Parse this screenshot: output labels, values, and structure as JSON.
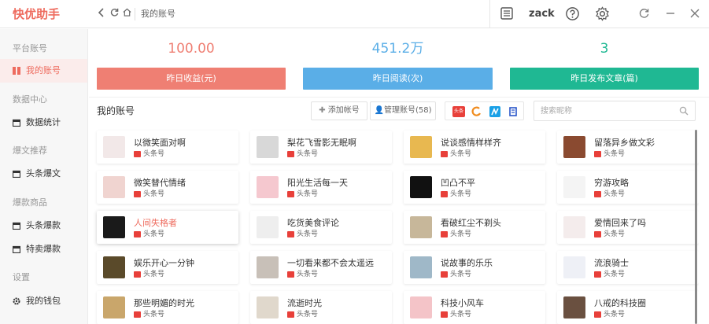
{
  "app": {
    "title": "快优助手",
    "breadcrumb": "我的账号",
    "user": "zack"
  },
  "sidebar": {
    "groups": [
      {
        "label": "平台账号",
        "items": [
          {
            "label": "我的账号",
            "icon": "account-icon",
            "active": true
          }
        ]
      },
      {
        "label": "数据中心",
        "items": [
          {
            "label": "数据统计",
            "icon": "calendar-icon",
            "active": false
          }
        ]
      },
      {
        "label": "爆文推荐",
        "items": [
          {
            "label": "头条爆文",
            "icon": "calendar-icon",
            "active": false
          }
        ]
      },
      {
        "label": "爆款商品",
        "items": [
          {
            "label": "头条爆款",
            "icon": "calendar-icon",
            "active": false
          },
          {
            "label": "特卖爆款",
            "icon": "calendar-icon",
            "active": false
          }
        ]
      },
      {
        "label": "设置",
        "items": [
          {
            "label": "我的钱包",
            "icon": "gear-icon",
            "active": false
          }
        ]
      }
    ]
  },
  "stats": [
    {
      "value": "100.00",
      "label": "昨日收益(元)",
      "color": "#ef7f73"
    },
    {
      "value": "451.2万",
      "label": "昨日阅读(次)",
      "color": "#5aaee7"
    },
    {
      "value": "3",
      "label": "昨日发布文章(篇)",
      "color": "#1fb893"
    }
  ],
  "toolbar": {
    "title": "我的账号",
    "add_label": "添加帐号",
    "manage_label": "管理账号(58)",
    "search_placeholder": "搜索昵称",
    "filters": [
      {
        "icon": "toutiao-icon",
        "text": "头条",
        "color": "#e8403a"
      },
      {
        "icon": "sogou-icon",
        "text": "",
        "color": "#ffffff"
      },
      {
        "icon": "dayu-icon",
        "text": "",
        "color": "#1aa0e6"
      },
      {
        "icon": "baijia-icon",
        "text": "",
        "color": "#ffffff"
      }
    ]
  },
  "accounts": [
    {
      "name": "以微笑面对啊",
      "platform": "头条号",
      "avatar_color": "#f2e8e8"
    },
    {
      "name": "梨花飞雪影无眠啊",
      "platform": "头条号",
      "avatar_color": "#d8d8d8"
    },
    {
      "name": "说谈感情样样齐",
      "platform": "头条号",
      "avatar_color": "#e8b850"
    },
    {
      "name": "留落异乡做文彩",
      "platform": "头条号",
      "avatar_color": "#8a4a30"
    },
    {
      "name": "微笑替代情绪",
      "platform": "头条号",
      "avatar_color": "#f0d4d0"
    },
    {
      "name": "阳光生活每一天",
      "platform": "头条号",
      "avatar_color": "#f5c8cf"
    },
    {
      "name": "凹凸不平",
      "platform": "头条号",
      "avatar_color": "#111111"
    },
    {
      "name": "穷游攻略",
      "platform": "头条号",
      "avatar_color": "#f4f4f4"
    },
    {
      "name": "人间失格者",
      "platform": "头条号",
      "avatar_color": "#1a1a1a"
    },
    {
      "name": "吃货美食评论",
      "platform": "头条号",
      "avatar_color": "#eeeeee"
    },
    {
      "name": "看破红尘不剃头",
      "platform": "头条号",
      "avatar_color": "#c7b79a"
    },
    {
      "name": "爱情回来了吗",
      "platform": "头条号",
      "avatar_color": "#f4ecec"
    },
    {
      "name": "娱乐开心一分钟",
      "platform": "头条号",
      "avatar_color": "#5a4a2a"
    },
    {
      "name": "一切看来都不会太遥远",
      "platform": "头条号",
      "avatar_color": "#c8c0b8"
    },
    {
      "name": "说故事的乐乐",
      "platform": "头条号",
      "avatar_color": "#9fb8c8"
    },
    {
      "name": "流浪骑士",
      "platform": "头条号",
      "avatar_color": "#eef0f6"
    },
    {
      "name": "那些明媚的时光",
      "platform": "头条号",
      "avatar_color": "#c9a66b"
    },
    {
      "name": "流逝时光",
      "platform": "头条号",
      "avatar_color": "#e0d8cc"
    },
    {
      "name": "科技小风车",
      "platform": "头条号",
      "avatar_color": "#f4c4c8"
    },
    {
      "name": "八戒的科技圈",
      "platform": "头条号",
      "avatar_color": "#6a5040"
    }
  ]
}
